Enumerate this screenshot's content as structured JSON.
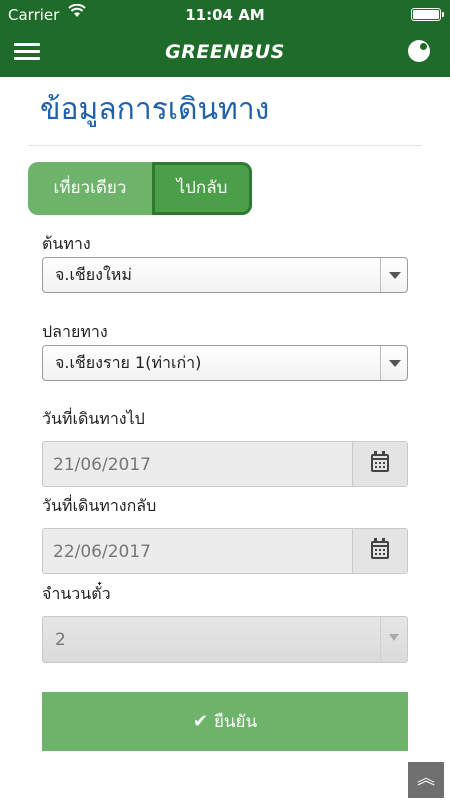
{
  "status_bar": {
    "carrier": "Carrier",
    "time": "11:04 AM"
  },
  "header": {
    "brand": "GREENBUS"
  },
  "page": {
    "title": "ข้อมูลการเดินทาง"
  },
  "trip_type": {
    "one_way": "เที่ยวเดียว",
    "round_trip": "ไปกลับ",
    "selected": "round_trip"
  },
  "origin": {
    "label": "ต้นทาง",
    "value": "จ.เชียงใหม่"
  },
  "destination": {
    "label": "ปลายทาง",
    "value": "จ.เชียงราย 1(ท่าเก่า)"
  },
  "depart_date": {
    "label": "วันที่เดินทางไป",
    "value": "21/06/2017"
  },
  "return_date": {
    "label": "วันที่เดินทางกลับ",
    "value": "22/06/2017"
  },
  "seats": {
    "label": "จำนวนตั๋ว",
    "value": "2"
  },
  "confirm": {
    "label": "ยืนยัน"
  },
  "icons": [
    "wifi-icon",
    "battery-icon",
    "menu-icon",
    "profile-icon",
    "calendar-icon",
    "check-icon",
    "chevron-up-double-icon"
  ],
  "colors": {
    "header": "#1e6b2a",
    "accent_green": "#6db36a",
    "title_blue": "#1f62a8"
  }
}
